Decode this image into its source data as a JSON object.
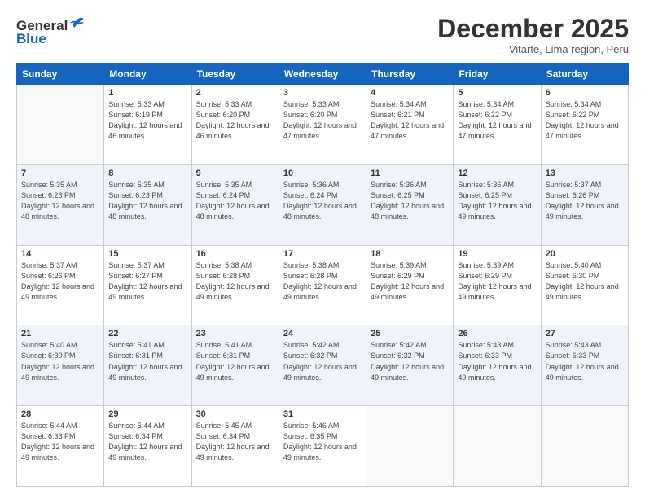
{
  "header": {
    "logo": {
      "line1": "General",
      "line2": "Blue"
    },
    "title": "December 2025",
    "subtitle": "Vitarte, Lima region, Peru"
  },
  "weekdays": [
    "Sunday",
    "Monday",
    "Tuesday",
    "Wednesday",
    "Thursday",
    "Friday",
    "Saturday"
  ],
  "weeks": [
    [
      {
        "day": "",
        "sunrise": "",
        "sunset": "",
        "daylight": ""
      },
      {
        "day": "1",
        "sunrise": "Sunrise: 5:33 AM",
        "sunset": "Sunset: 6:19 PM",
        "daylight": "Daylight: 12 hours and 46 minutes."
      },
      {
        "day": "2",
        "sunrise": "Sunrise: 5:33 AM",
        "sunset": "Sunset: 6:20 PM",
        "daylight": "Daylight: 12 hours and 46 minutes."
      },
      {
        "day": "3",
        "sunrise": "Sunrise: 5:33 AM",
        "sunset": "Sunset: 6:20 PM",
        "daylight": "Daylight: 12 hours and 47 minutes."
      },
      {
        "day": "4",
        "sunrise": "Sunrise: 5:34 AM",
        "sunset": "Sunset: 6:21 PM",
        "daylight": "Daylight: 12 hours and 47 minutes."
      },
      {
        "day": "5",
        "sunrise": "Sunrise: 5:34 AM",
        "sunset": "Sunset: 6:22 PM",
        "daylight": "Daylight: 12 hours and 47 minutes."
      },
      {
        "day": "6",
        "sunrise": "Sunrise: 5:34 AM",
        "sunset": "Sunset: 6:22 PM",
        "daylight": "Daylight: 12 hours and 47 minutes."
      }
    ],
    [
      {
        "day": "7",
        "sunrise": "Sunrise: 5:35 AM",
        "sunset": "Sunset: 6:23 PM",
        "daylight": "Daylight: 12 hours and 48 minutes."
      },
      {
        "day": "8",
        "sunrise": "Sunrise: 5:35 AM",
        "sunset": "Sunset: 6:23 PM",
        "daylight": "Daylight: 12 hours and 48 minutes."
      },
      {
        "day": "9",
        "sunrise": "Sunrise: 5:35 AM",
        "sunset": "Sunset: 6:24 PM",
        "daylight": "Daylight: 12 hours and 48 minutes."
      },
      {
        "day": "10",
        "sunrise": "Sunrise: 5:36 AM",
        "sunset": "Sunset: 6:24 PM",
        "daylight": "Daylight: 12 hours and 48 minutes."
      },
      {
        "day": "11",
        "sunrise": "Sunrise: 5:36 AM",
        "sunset": "Sunset: 6:25 PM",
        "daylight": "Daylight: 12 hours and 48 minutes."
      },
      {
        "day": "12",
        "sunrise": "Sunrise: 5:36 AM",
        "sunset": "Sunset: 6:25 PM",
        "daylight": "Daylight: 12 hours and 49 minutes."
      },
      {
        "day": "13",
        "sunrise": "Sunrise: 5:37 AM",
        "sunset": "Sunset: 6:26 PM",
        "daylight": "Daylight: 12 hours and 49 minutes."
      }
    ],
    [
      {
        "day": "14",
        "sunrise": "Sunrise: 5:37 AM",
        "sunset": "Sunset: 6:26 PM",
        "daylight": "Daylight: 12 hours and 49 minutes."
      },
      {
        "day": "15",
        "sunrise": "Sunrise: 5:37 AM",
        "sunset": "Sunset: 6:27 PM",
        "daylight": "Daylight: 12 hours and 49 minutes."
      },
      {
        "day": "16",
        "sunrise": "Sunrise: 5:38 AM",
        "sunset": "Sunset: 6:28 PM",
        "daylight": "Daylight: 12 hours and 49 minutes."
      },
      {
        "day": "17",
        "sunrise": "Sunrise: 5:38 AM",
        "sunset": "Sunset: 6:28 PM",
        "daylight": "Daylight: 12 hours and 49 minutes."
      },
      {
        "day": "18",
        "sunrise": "Sunrise: 5:39 AM",
        "sunset": "Sunset: 6:29 PM",
        "daylight": "Daylight: 12 hours and 49 minutes."
      },
      {
        "day": "19",
        "sunrise": "Sunrise: 5:39 AM",
        "sunset": "Sunset: 6:29 PM",
        "daylight": "Daylight: 12 hours and 49 minutes."
      },
      {
        "day": "20",
        "sunrise": "Sunrise: 5:40 AM",
        "sunset": "Sunset: 6:30 PM",
        "daylight": "Daylight: 12 hours and 49 minutes."
      }
    ],
    [
      {
        "day": "21",
        "sunrise": "Sunrise: 5:40 AM",
        "sunset": "Sunset: 6:30 PM",
        "daylight": "Daylight: 12 hours and 49 minutes."
      },
      {
        "day": "22",
        "sunrise": "Sunrise: 5:41 AM",
        "sunset": "Sunset: 6:31 PM",
        "daylight": "Daylight: 12 hours and 49 minutes."
      },
      {
        "day": "23",
        "sunrise": "Sunrise: 5:41 AM",
        "sunset": "Sunset: 6:31 PM",
        "daylight": "Daylight: 12 hours and 49 minutes."
      },
      {
        "day": "24",
        "sunrise": "Sunrise: 5:42 AM",
        "sunset": "Sunset: 6:32 PM",
        "daylight": "Daylight: 12 hours and 49 minutes."
      },
      {
        "day": "25",
        "sunrise": "Sunrise: 5:42 AM",
        "sunset": "Sunset: 6:32 PM",
        "daylight": "Daylight: 12 hours and 49 minutes."
      },
      {
        "day": "26",
        "sunrise": "Sunrise: 5:43 AM",
        "sunset": "Sunset: 6:33 PM",
        "daylight": "Daylight: 12 hours and 49 minutes."
      },
      {
        "day": "27",
        "sunrise": "Sunrise: 5:43 AM",
        "sunset": "Sunset: 6:33 PM",
        "daylight": "Daylight: 12 hours and 49 minutes."
      }
    ],
    [
      {
        "day": "28",
        "sunrise": "Sunrise: 5:44 AM",
        "sunset": "Sunset: 6:33 PM",
        "daylight": "Daylight: 12 hours and 49 minutes."
      },
      {
        "day": "29",
        "sunrise": "Sunrise: 5:44 AM",
        "sunset": "Sunset: 6:34 PM",
        "daylight": "Daylight: 12 hours and 49 minutes."
      },
      {
        "day": "30",
        "sunrise": "Sunrise: 5:45 AM",
        "sunset": "Sunset: 6:34 PM",
        "daylight": "Daylight: 12 hours and 49 minutes."
      },
      {
        "day": "31",
        "sunrise": "Sunrise: 5:46 AM",
        "sunset": "Sunset: 6:35 PM",
        "daylight": "Daylight: 12 hours and 49 minutes."
      },
      {
        "day": "",
        "sunrise": "",
        "sunset": "",
        "daylight": ""
      },
      {
        "day": "",
        "sunrise": "",
        "sunset": "",
        "daylight": ""
      },
      {
        "day": "",
        "sunrise": "",
        "sunset": "",
        "daylight": ""
      }
    ]
  ]
}
